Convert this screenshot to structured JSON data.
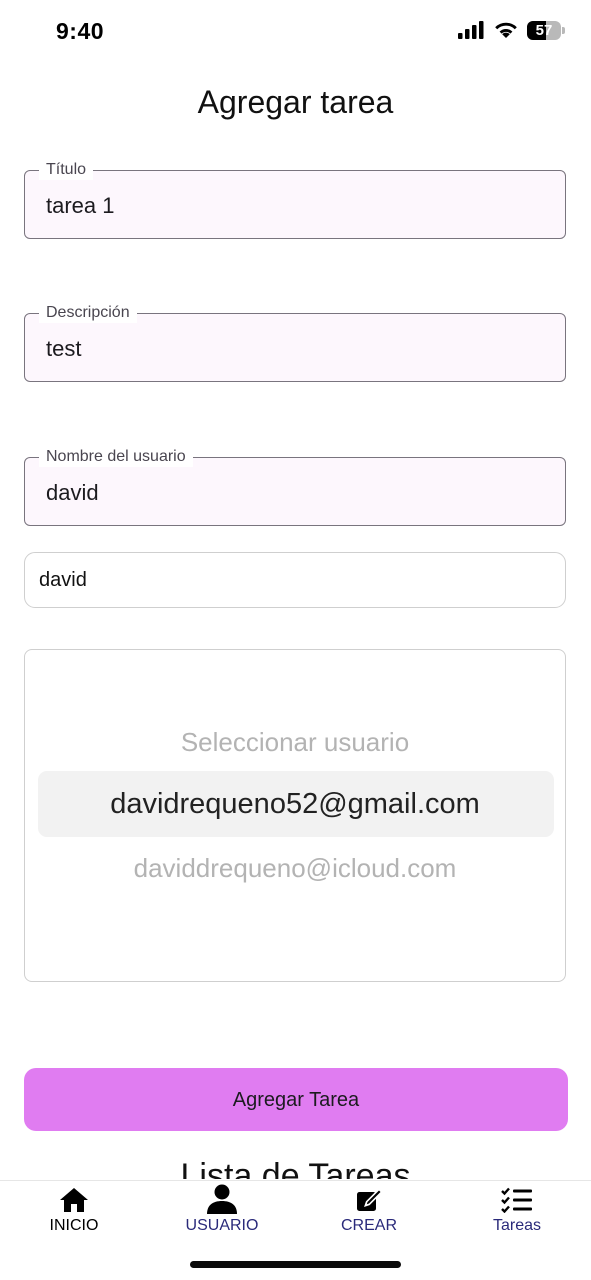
{
  "status_bar": {
    "time": "9:40",
    "battery_level": "57",
    "battery_fraction": 0.57,
    "icons": [
      "signal-icon",
      "wifi-icon",
      "battery-icon"
    ]
  },
  "header": {
    "title": "Agregar tarea"
  },
  "form": {
    "title_field": {
      "label": "Título",
      "value": "tarea 1"
    },
    "description_field": {
      "label": "Descripción",
      "value": "test"
    },
    "user_field": {
      "label": "Nombre del usuario",
      "value": "david"
    },
    "search": {
      "value": "david"
    },
    "user_picker": {
      "placeholder": "Seleccionar usuario",
      "options": [
        "davidrequeno52@gmail.com",
        "daviddrequeno@icloud.com"
      ],
      "selected": "davidrequeno52@gmail.com"
    },
    "submit_label": "Agregar Tarea"
  },
  "list": {
    "title": "Lista de Tareas"
  },
  "tab_bar": {
    "tabs": [
      {
        "label": "INICIO",
        "icon": "home-icon",
        "color": "#000000"
      },
      {
        "label": "USUARIO",
        "icon": "user-icon",
        "color": "#2a2a7a"
      },
      {
        "label": "CREAR",
        "icon": "edit-icon",
        "color": "#2a2a7a"
      },
      {
        "label": "Tareas",
        "icon": "task-list-icon",
        "color": "#2a2a7a"
      }
    ]
  },
  "colors": {
    "accent_button": "#e07cf1",
    "field_background": "#fdf7fd",
    "inactive_tab": "#2a2a7a"
  }
}
